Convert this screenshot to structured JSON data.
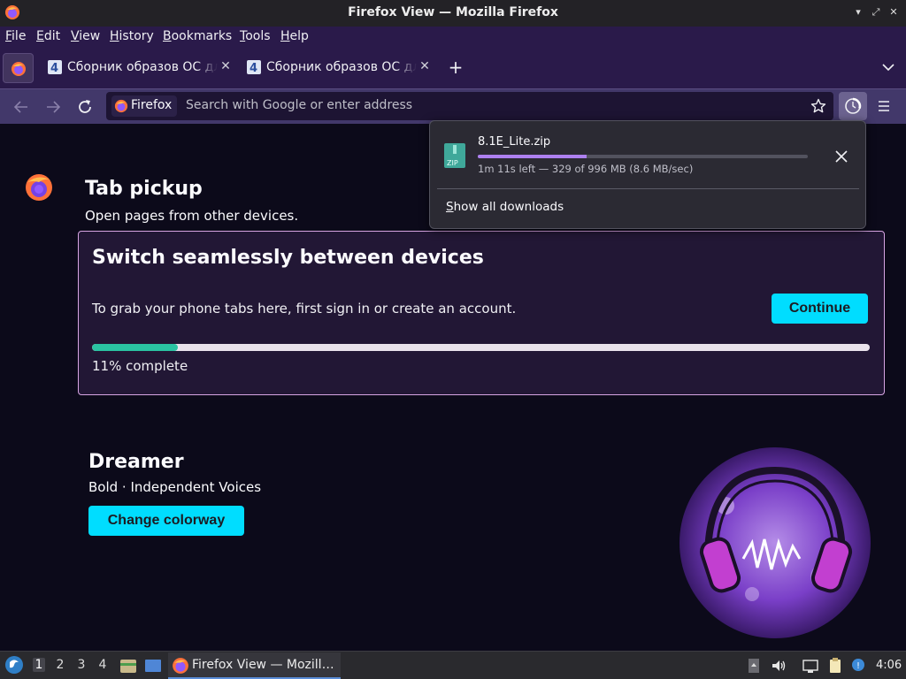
{
  "window": {
    "title": "Firefox View — Mozilla Firefox"
  },
  "menu": [
    "File",
    "Edit",
    "View",
    "History",
    "Bookmarks",
    "Tools",
    "Help"
  ],
  "tabs": [
    {
      "title": "Сборник образов ОС для"
    },
    {
      "title": "Сборник образов ОС для"
    }
  ],
  "navbar": {
    "identity_label": "Firefox",
    "url_placeholder": "Search with Google or enter address"
  },
  "downloads": {
    "filename": "8.1E_Lite.zip",
    "status": "1m 11s left — 329 of 996 MB (8.6 MB/sec)",
    "progress": 0.33,
    "show_all": "Show all downloads"
  },
  "tab_pickup": {
    "heading": "Tab pickup",
    "subheading": "Open pages from other devices.",
    "card_title": "Switch seamlessly between devices",
    "card_text": "To grab your phone tabs here, first sign in or create an account.",
    "continue_label": "Continue",
    "progress": 0.11,
    "progress_label": "11% complete"
  },
  "colorway": {
    "title": "Dreamer",
    "subtitle": "Bold · Independent Voices",
    "button_label": "Change colorway"
  },
  "taskbar": {
    "workspaces": [
      "1",
      "2",
      "3",
      "4"
    ],
    "active_workspace": "1",
    "task_label": "Firefox View — Mozill…",
    "clock": "4:06"
  },
  "colors": {
    "accent_button": "#00ddff",
    "chrome_bg": "#2a1a4a",
    "content_bg": "#0c0a1a",
    "progress_fill": "#2ac3a2",
    "download_fill": "#ad80f0"
  }
}
